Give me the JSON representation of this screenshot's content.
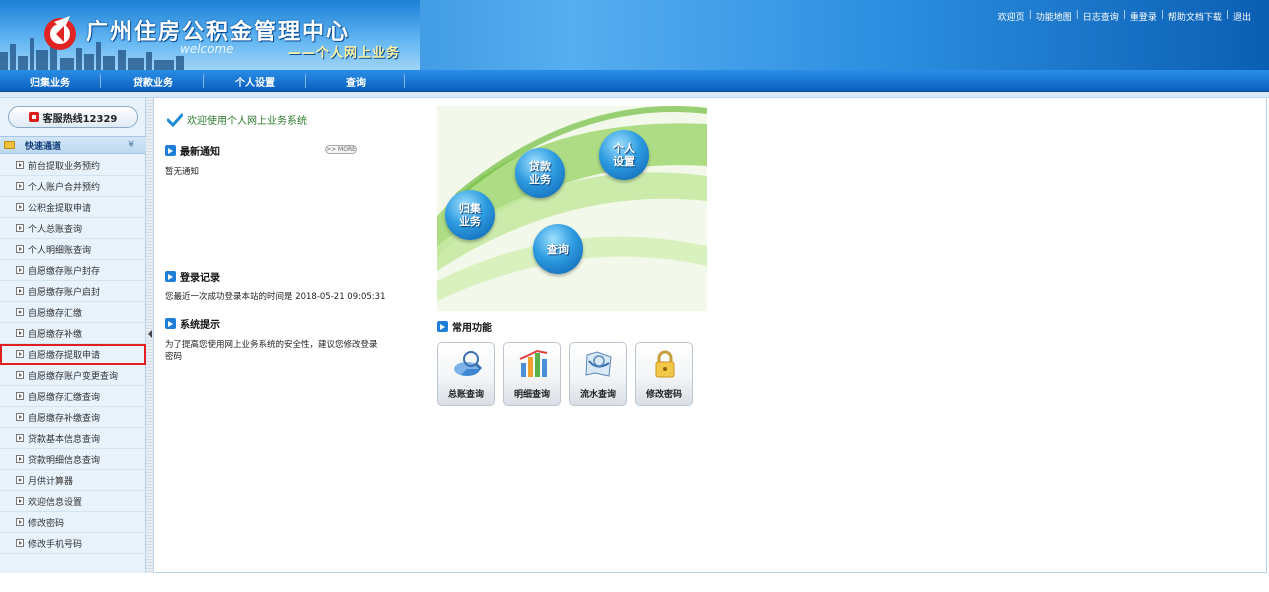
{
  "header": {
    "site_title": "广州住房公积金管理中心",
    "welcome_en": "welcome",
    "welcome_sub": "——个人网上业务",
    "top_links": [
      "欢迎页",
      "功能地图",
      "日志查询",
      "重登录",
      "帮助文档下载",
      "退出"
    ]
  },
  "nav": {
    "items": [
      "归集业务",
      "贷款业务",
      "个人设置",
      "查询"
    ]
  },
  "sidebar": {
    "hotline": "客服热线12329",
    "quick_title": "快速通道",
    "items": [
      "前台提取业务预约",
      "个人账户合并预约",
      "公积金提取申请",
      "个人总账查询",
      "个人明细账查询",
      "自愿缴存账户封存",
      "自愿缴存账户启封",
      "自愿缴存汇缴",
      "自愿缴存补缴",
      "自愿缴存提取申请",
      "自愿缴存账户变更查询",
      "自愿缴存汇缴查询",
      "自愿缴存补缴查询",
      "贷款基本信息查询",
      "贷款明细信息查询",
      "月供计算器",
      "欢迎信息设置",
      "修改密码",
      "修改手机号码"
    ],
    "selected_index": 9
  },
  "main": {
    "welcome": "欢迎使用个人网上业务系统",
    "notice_title": "最新通知",
    "more_label": ">> MORE",
    "notice_text": "暂无通知",
    "login_title": "登录记录",
    "login_text": "您最近一次成功登录本站的时间是 2018-05-21 09:05:31",
    "tips_title": "系统提示",
    "tips_text": "为了提高您使用网上业务系统的安全性，建议您修改登录密码",
    "banner": {
      "bubbles": [
        "归集业务",
        "贷款业务",
        "个人设置",
        "查询"
      ]
    },
    "func_title": "常用功能",
    "functions": [
      {
        "label": "总账查询",
        "icon": "ledger-chart-icon"
      },
      {
        "label": "明细查询",
        "icon": "detail-chart-icon"
      },
      {
        "label": "流水查询",
        "icon": "flow-map-icon"
      },
      {
        "label": "修改密码",
        "icon": "lock-icon"
      }
    ]
  },
  "colors": {
    "header_blue": "#1b7fd6",
    "nav_blue": "#0a5fc0",
    "sidebar_bg": "#e7f2fb",
    "selection_red": "#e02020"
  }
}
